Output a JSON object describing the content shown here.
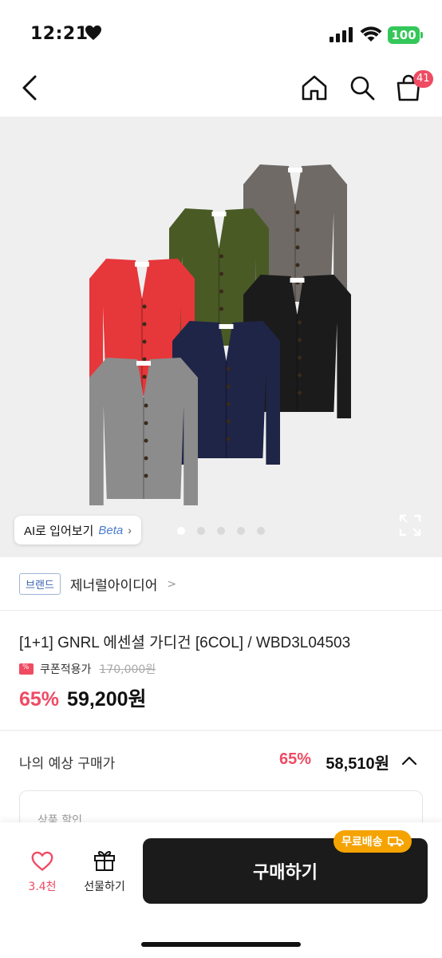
{
  "status": {
    "time": "12:21",
    "battery": "100"
  },
  "nav": {
    "cart_count": "41"
  },
  "hero": {
    "ai_label": "AI로 입어보기",
    "ai_beta": "Beta",
    "ai_chevron": "›",
    "slide_count": 5,
    "active_slide": 1,
    "garment_colors": [
      "#6f6a66",
      "#4a5a25",
      "#e6373a",
      "#1b1b1b",
      "#1f2547",
      "#8c8c8c"
    ]
  },
  "brand": {
    "tag": "브랜드",
    "name": "제너럴아이디어",
    "chevron": ">"
  },
  "product": {
    "title": "[1+1] GNRL 에센셜 가디건 [6COL] / WBD3L04503",
    "coupon_label": "쿠폰적용가",
    "original_price": "170,000원",
    "discount": "65%",
    "price": "59,200원"
  },
  "estimate": {
    "label": "나의 예상 구매가",
    "discount": "65%",
    "price": "58,510원"
  },
  "detail": {
    "first_label": "상품 할인"
  },
  "bottom": {
    "like_count": "3.4천",
    "gift_label": "선물하기",
    "buy_label": "구매하기",
    "free_ship_label": "무료배송"
  },
  "colors": {
    "accent": "#ef4b63",
    "buy_bg": "#1b1b1b",
    "free_ship": "#f5a300",
    "battery": "#34c759"
  }
}
